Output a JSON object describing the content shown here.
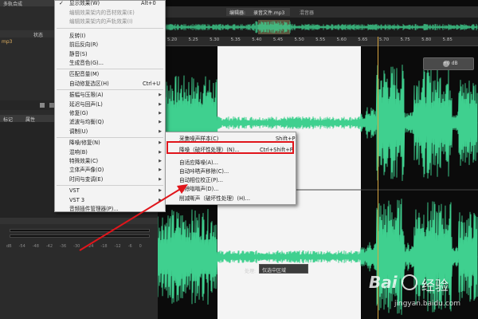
{
  "top_menu": {
    "checked_item": "显示效果(W)",
    "checked_shortcut": "Alt+0"
  },
  "left_panel": {
    "file_tab": "多轨合成",
    "file_name": "mp3",
    "status_label": "状态",
    "panel_tab_a": "标记",
    "panel_tab_b": "属性",
    "meter_ticks": [
      "dB",
      "-54",
      "-48",
      "-42",
      "-36",
      "-30",
      "-24",
      "-18",
      "-12",
      "-6",
      "0"
    ]
  },
  "editor": {
    "tab_prefix": "编辑器: ",
    "file_title": "录音文件.mp3",
    "mixer_tab": "混音器",
    "ruler_ticks": [
      "5.20",
      "5.25",
      "5.30",
      "5.35",
      "5.40",
      "5.45",
      "5.50",
      "5.55",
      "5.60",
      "5.65",
      "5.70",
      "5.75",
      "5.80",
      "5.85"
    ],
    "hud_value": "+0 dB",
    "process_label": "处理:",
    "process_option": "仅选中区域"
  },
  "effects_menu": {
    "items": [
      {
        "label": "编辑效果架内的音材效果(E)",
        "dim": true
      },
      {
        "label": "编辑效果架内的声轨效果(I)",
        "dim": true
      },
      {
        "label": "反转(I)"
      },
      {
        "label": "前后反向(R)"
      },
      {
        "label": "静音(S)"
      },
      {
        "label": "生成音色(G)..."
      },
      {
        "label": "匹配音量(M)"
      },
      {
        "label": "自动修复选区(H)",
        "shortcut": "Ctrl+U"
      },
      {
        "label": "振幅与压限(A)",
        "submenu": true
      },
      {
        "label": "延迟与回声(L)",
        "submenu": true
      },
      {
        "label": "修复(G)",
        "submenu": true
      },
      {
        "label": "滤波与均衡(Q)",
        "submenu": true
      },
      {
        "label": "调制(U)",
        "submenu": true
      },
      {
        "label": "降噪/修复(N)",
        "submenu": true
      },
      {
        "label": "混响(B)",
        "submenu": true
      },
      {
        "label": "特殊效果(C)",
        "submenu": true
      },
      {
        "label": "立体声声像(O)",
        "submenu": true
      },
      {
        "label": "时间与变调(E)",
        "submenu": true
      },
      {
        "label": "VST",
        "submenu": true
      },
      {
        "label": "VST 3",
        "submenu": true
      },
      {
        "label": "音频插件管理器(P)..."
      }
    ]
  },
  "noise_submenu": {
    "items": [
      {
        "label": "采集噪声样本(C)",
        "shortcut": "Shift+P"
      },
      {
        "label": "降噪（破坏性处理）(N)...",
        "shortcut": "Ctrl+Shift+P"
      },
      {
        "label": "自适应降噪(A)..."
      },
      {
        "label": "自动咔嗒声移除(C)..."
      },
      {
        "label": "自动相位校正(P)..."
      },
      {
        "label": "去除嗡嗡声(D)..."
      },
      {
        "label": "削减嘶声（破坏性处理）(H)..."
      }
    ]
  },
  "watermark": {
    "brand": "Bai",
    "brand_cn": "经验",
    "url": "jingyan.baidu.com"
  },
  "colors": {
    "waveform": "#3fd08f",
    "highlight": "#e0151b",
    "arrow": "#e0151b",
    "playhead": "#d9a640"
  }
}
